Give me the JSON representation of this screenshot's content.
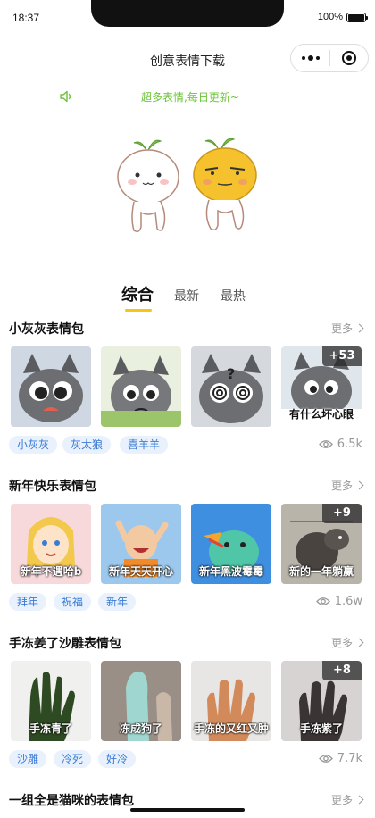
{
  "status_bar": {
    "time": "18:37",
    "battery": "100%"
  },
  "navbar": {
    "title": "创意表情下载"
  },
  "notice": {
    "text": "超多表情,每日更新~"
  },
  "tabs": [
    {
      "label": "综合"
    },
    {
      "label": "最新"
    },
    {
      "label": "最热"
    }
  ],
  "sections": [
    {
      "title": "小灰灰表情包",
      "more": "更多",
      "thumbs": [
        {
          "caption": ""
        },
        {
          "caption": ""
        },
        {
          "caption": ""
        },
        {
          "caption": "有什么坏心眼",
          "count": "+53"
        }
      ],
      "tags": [
        "小灰灰",
        "灰太狼",
        "喜羊羊"
      ],
      "views": "6.5k"
    },
    {
      "title": "新年快乐表情包",
      "more": "更多",
      "thumbs": [
        {
          "caption": "新年不遇哈b"
        },
        {
          "caption": "新年天天开心"
        },
        {
          "caption": "新年黑波霉霉"
        },
        {
          "caption": "新的一年躺赢",
          "count": "+9"
        }
      ],
      "tags": [
        "拜年",
        "祝福",
        "新年"
      ],
      "views": "1.6w"
    },
    {
      "title": "手冻姜了沙雕表情包",
      "more": "更多",
      "thumbs": [
        {
          "caption": "手冻青了"
        },
        {
          "caption": "冻成狗了"
        },
        {
          "caption": "手冻的又红又肿"
        },
        {
          "caption": "手冻紫了",
          "count": "+8"
        }
      ],
      "tags": [
        "沙雕",
        "冷死",
        "好冷"
      ],
      "views": "7.7k"
    },
    {
      "title": "一组全是猫咪的表情包",
      "more": "更多"
    }
  ],
  "colors": {
    "accent_green": "#6cc43a",
    "tab_underline": "#f5c518",
    "tag_bg": "#e8f1fc",
    "tag_text": "#3a7bd5"
  }
}
